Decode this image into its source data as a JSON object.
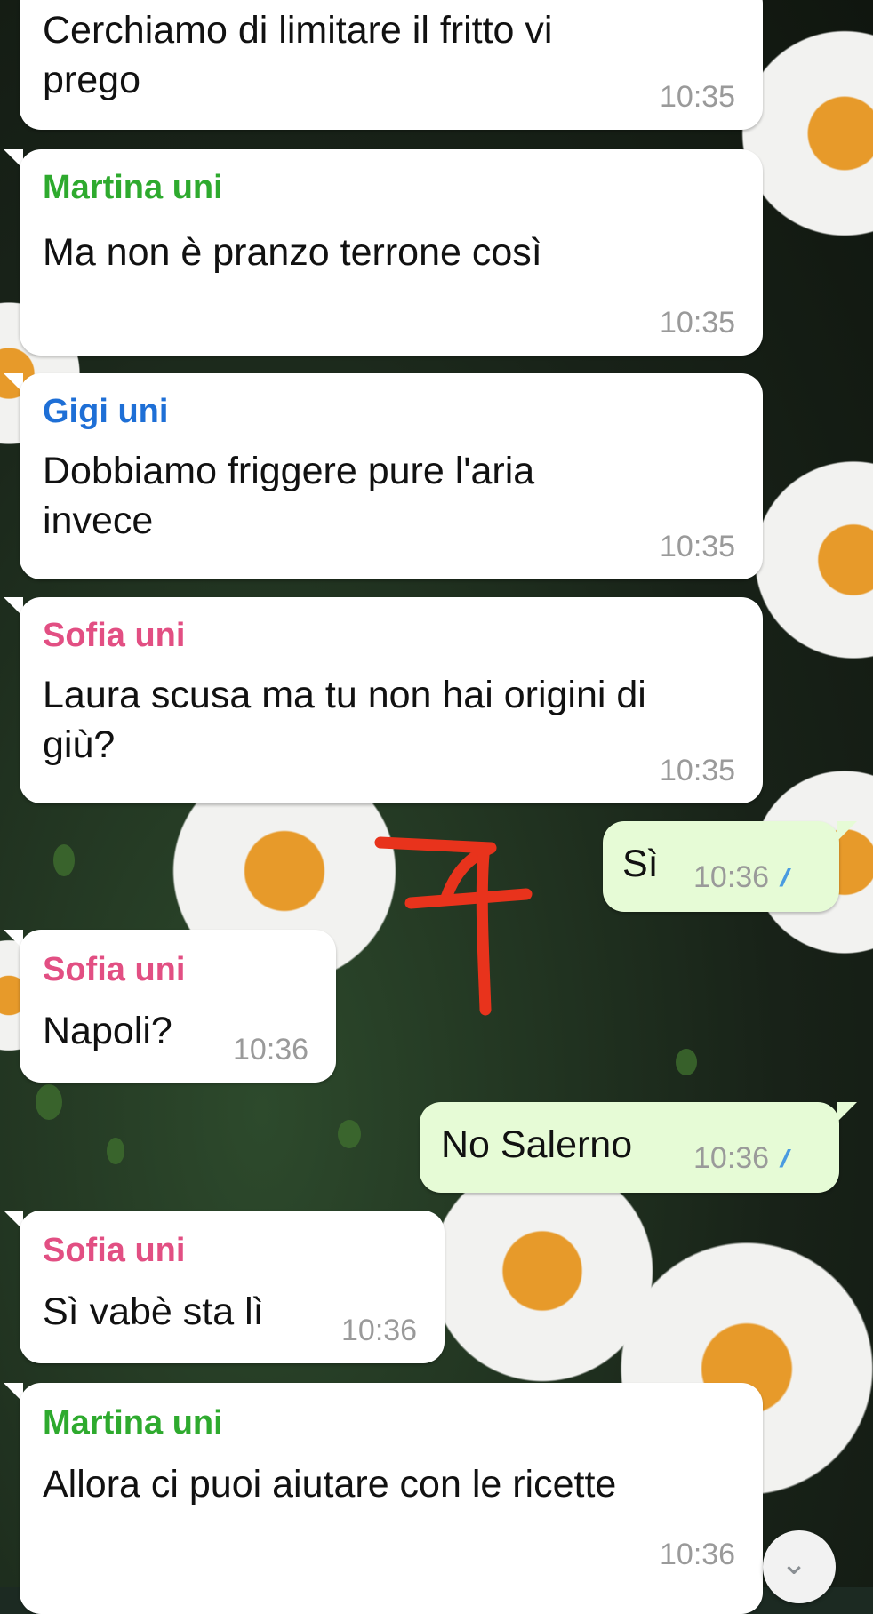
{
  "colors": {
    "bubble_in": "#ffffff",
    "bubble_out": "#e6fbd6",
    "time": "#9a9a9a",
    "read_ticks": "#4a9be0",
    "sender_martina": "#2eaa2e",
    "sender_gigi": "#1e6fd6",
    "sender_sofia": "#e24f83",
    "annotation_red": "#e8331c"
  },
  "messages": [
    {
      "direction": "in",
      "sender": "",
      "text": "Cerchiamo di limitare il fritto vi\nprego",
      "time": "10:35"
    },
    {
      "direction": "in",
      "sender": "Martina uni",
      "text": "Ma non è pranzo terrone così",
      "time": "10:35"
    },
    {
      "direction": "in",
      "sender": "Gigi uni",
      "text": "Dobbiamo friggere pure l'aria\ninvece",
      "time": "10:35"
    },
    {
      "direction": "in",
      "sender": "Sofia uni",
      "text": "Laura scusa ma tu non hai origini di\ngiù?",
      "time": "10:35"
    },
    {
      "direction": "out",
      "sender": "",
      "text": "Sì",
      "time": "10:36",
      "status": "read-ticks-icon"
    },
    {
      "direction": "in",
      "sender": "Sofia uni",
      "text": "Napoli?",
      "time": "10:36"
    },
    {
      "direction": "out",
      "sender": "",
      "text": "No Salerno",
      "time": "10:36",
      "status": "read-ticks-icon"
    },
    {
      "direction": "in",
      "sender": "Sofia uni",
      "text": "Sì vabè sta lì",
      "time": "10:36"
    },
    {
      "direction": "in",
      "sender": "Martina uni",
      "text": "Allora ci puoi aiutare con le ricette",
      "time": "10:36"
    }
  ],
  "ticks_glyph": "//",
  "scroll_button": {
    "icon": "chevron-down-icon",
    "glyph": "⌄"
  }
}
